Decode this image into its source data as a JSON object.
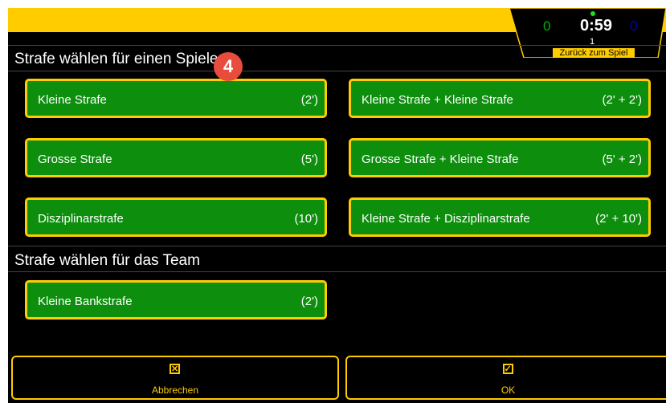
{
  "scoreboard": {
    "home_score": "0",
    "clock": "0:59",
    "away_score": "0",
    "period": "1",
    "back_label": "Zurück zum Spiel"
  },
  "sections": {
    "player_title": "Strafe wählen für einen Spieler",
    "team_title": "Strafe wählen für das Team"
  },
  "player_penalties": [
    {
      "label": "Kleine Strafe",
      "duration": "(2')"
    },
    {
      "label": "Kleine Strafe + Kleine Strafe",
      "duration": "(2' + 2')"
    },
    {
      "label": "Grosse Strafe",
      "duration": "(5')"
    },
    {
      "label": "Grosse Strafe + Kleine Strafe",
      "duration": "(5' + 2')"
    },
    {
      "label": "Disziplinarstrafe",
      "duration": "(10')"
    },
    {
      "label": "Kleine Strafe + Disziplinarstrafe",
      "duration": "(2' + 10')"
    }
  ],
  "team_penalties": [
    {
      "label": "Kleine Bankstrafe",
      "duration": "(2')"
    }
  ],
  "badge": "4",
  "footer": {
    "cancel_label": "Abbrechen",
    "cancel_icon": "x-box-icon",
    "ok_label": "OK",
    "ok_icon": "checkbox-icon"
  },
  "colors": {
    "accent": "#ffcc00",
    "button_green": "#0d8f0d",
    "badge": "#e74c3c"
  }
}
